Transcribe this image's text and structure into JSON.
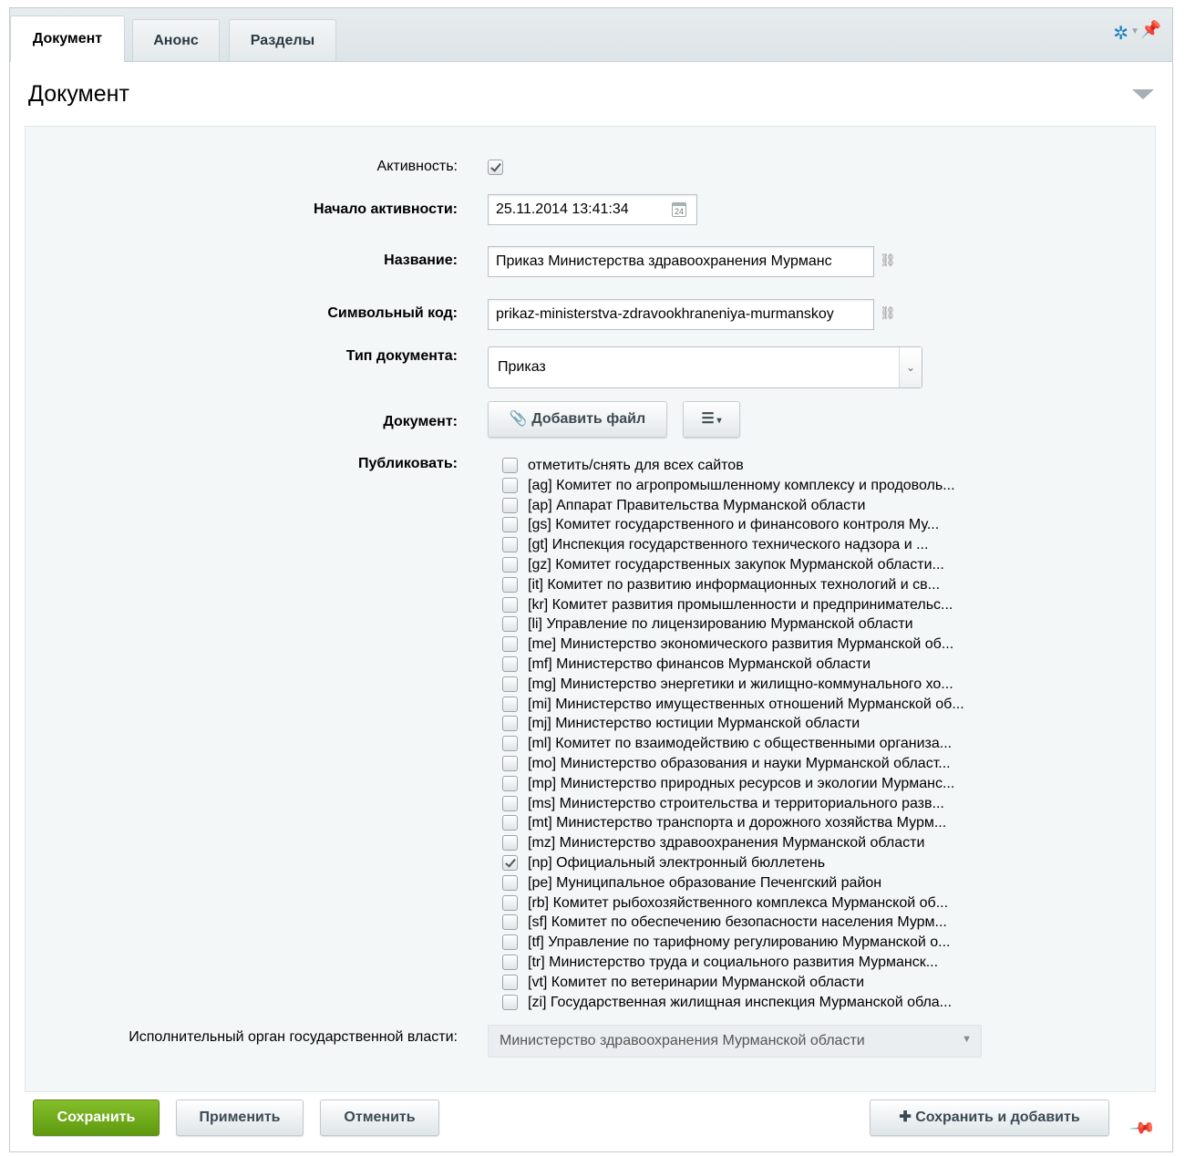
{
  "tabs": [
    {
      "label": "Документ",
      "active": true
    },
    {
      "label": "Анонс",
      "active": false
    },
    {
      "label": "Разделы",
      "active": false
    }
  ],
  "header_icons": {
    "settings": "gear-icon",
    "pin": "pin-icon"
  },
  "section_title": "Документ",
  "form": {
    "active_label": "Активность:",
    "active_checked": true,
    "start_label": "Начало активности:",
    "start_value": "25.11.2014 13:41:34",
    "calendar_day": "24",
    "name_label": "Название:",
    "name_value": "Приказ Министерства здравоохранения Мурманс",
    "code_label": "Символьный код:",
    "code_value": "prikaz-ministerstva-zdravookhraneniya-murmanskoy",
    "doctype_label": "Тип документа:",
    "doctype_value": "Приказ",
    "file_label": "Документ:",
    "add_file_label": "Добавить файл",
    "publish_label": "Публиковать:",
    "sites": [
      {
        "label": "отметить/снять для всех сайтов",
        "checked": false
      },
      {
        "label": "[ag] Комитет по агропромышленному комплексу и продоволь...",
        "checked": false
      },
      {
        "label": "[ap] Аппарат Правительства Мурманской области",
        "checked": false
      },
      {
        "label": "[gs] Комитет государственного и финансового контроля Му...",
        "checked": false
      },
      {
        "label": "[gt] Инспекция государственного технического надзора и ...",
        "checked": false
      },
      {
        "label": "[gz] Комитет государственных закупок Мурманской области...",
        "checked": false
      },
      {
        "label": "[it] Комитет по развитию информационных технологий и св...",
        "checked": false
      },
      {
        "label": "[kr] Комитет развития промышленности и предпринимательс...",
        "checked": false
      },
      {
        "label": "[li] Управление по лицензированию Мурманской области",
        "checked": false
      },
      {
        "label": "[me] Министерство экономического развития Мурманской об...",
        "checked": false
      },
      {
        "label": "[mf] Министерство финансов Мурманской области",
        "checked": false
      },
      {
        "label": "[mg] Министерство энергетики и жилищно-коммунального хо...",
        "checked": false
      },
      {
        "label": "[mi] Министерство имущественных отношений Мурманской об...",
        "checked": false
      },
      {
        "label": "[mj] Министерство юстиции Мурманской области",
        "checked": false
      },
      {
        "label": "[ml] Комитет по взаимодействию с общественными организа...",
        "checked": false
      },
      {
        "label": "[mo] Министерство образования и науки Мурманской област...",
        "checked": false
      },
      {
        "label": "[mp] Министерство природных ресурсов и экологии Мурманс...",
        "checked": false
      },
      {
        "label": "[ms] Министерство строительства и территориального разв...",
        "checked": false
      },
      {
        "label": "[mt] Министерство транспорта и дорожного хозяйства Мурм...",
        "checked": false
      },
      {
        "label": "[mz] Министерство здравоохранения Мурманской области",
        "checked": false
      },
      {
        "label": "[np] Официальный электронный бюллетень",
        "checked": true
      },
      {
        "label": "[pe] Муниципальное образование Печенгский район",
        "checked": false
      },
      {
        "label": "[rb] Комитет рыбохозяйственного комплекса Мурманской об...",
        "checked": false
      },
      {
        "label": "[sf] Комитет по обеспечению безопасности населения Мурм...",
        "checked": false
      },
      {
        "label": "[tf] Управление по тарифному регулированию Мурманской о...",
        "checked": false
      },
      {
        "label": "[tr] Министерство труда и социального развития Мурманск...",
        "checked": false
      },
      {
        "label": "[vt] Комитет по ветеринарии Мурманской области",
        "checked": false
      },
      {
        "label": "[zi] Государственная жилищная инспекция Мурманской обла...",
        "checked": false
      }
    ],
    "authority_label": "Исполнительный орган государственной власти:",
    "authority_value": "Министерство здравоохранения Мурманской области"
  },
  "footer": {
    "save": "Сохранить",
    "apply": "Применить",
    "cancel": "Отменить",
    "save_add": "Сохранить и добавить"
  },
  "colors": {
    "save_button": "#6aa61a",
    "accent": "#1a7fc1"
  }
}
